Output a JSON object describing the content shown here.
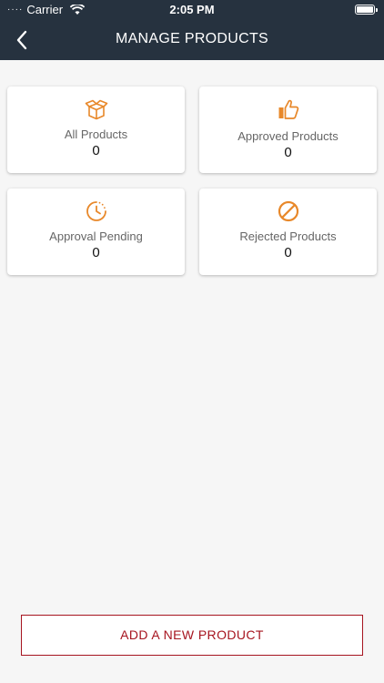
{
  "status_bar": {
    "carrier": "Carrier",
    "time": "2:05 PM"
  },
  "header": {
    "title": "MANAGE PRODUCTS",
    "back_icon": "chevron-left-icon"
  },
  "cards": [
    {
      "label": "All Products",
      "count": "0",
      "icon": "box-icon"
    },
    {
      "label": "Approved Products",
      "count": "0",
      "icon": "thumbs-up-icon"
    },
    {
      "label": "Approval Pending",
      "count": "0",
      "icon": "clock-icon"
    },
    {
      "label": "Rejected Products",
      "count": "0",
      "icon": "ban-icon"
    }
  ],
  "add_button_label": "ADD A NEW PRODUCT",
  "colors": {
    "header_bg": "#26323f",
    "accent": "#e8882a",
    "button": "#a6141f",
    "background": "#f6f6f6"
  }
}
